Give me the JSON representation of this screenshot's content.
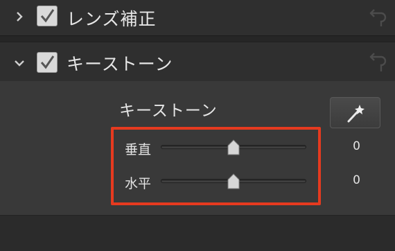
{
  "sections": {
    "lens": {
      "title": "レンズ補正",
      "checked": true,
      "expanded": false
    },
    "keystone": {
      "title": "キーストーン",
      "checked": true,
      "expanded": true
    }
  },
  "panel": {
    "title": "キーストーン",
    "auto_button_icon": "magic-wand-icon",
    "sliders": [
      {
        "label": "垂直",
        "value": "0",
        "position": 0.5
      },
      {
        "label": "水平",
        "value": "0",
        "position": 0.5
      }
    ]
  },
  "colors": {
    "highlight": "#e63a1f",
    "panel_bg": "#393939",
    "header_bg": "#2f2f2f"
  }
}
